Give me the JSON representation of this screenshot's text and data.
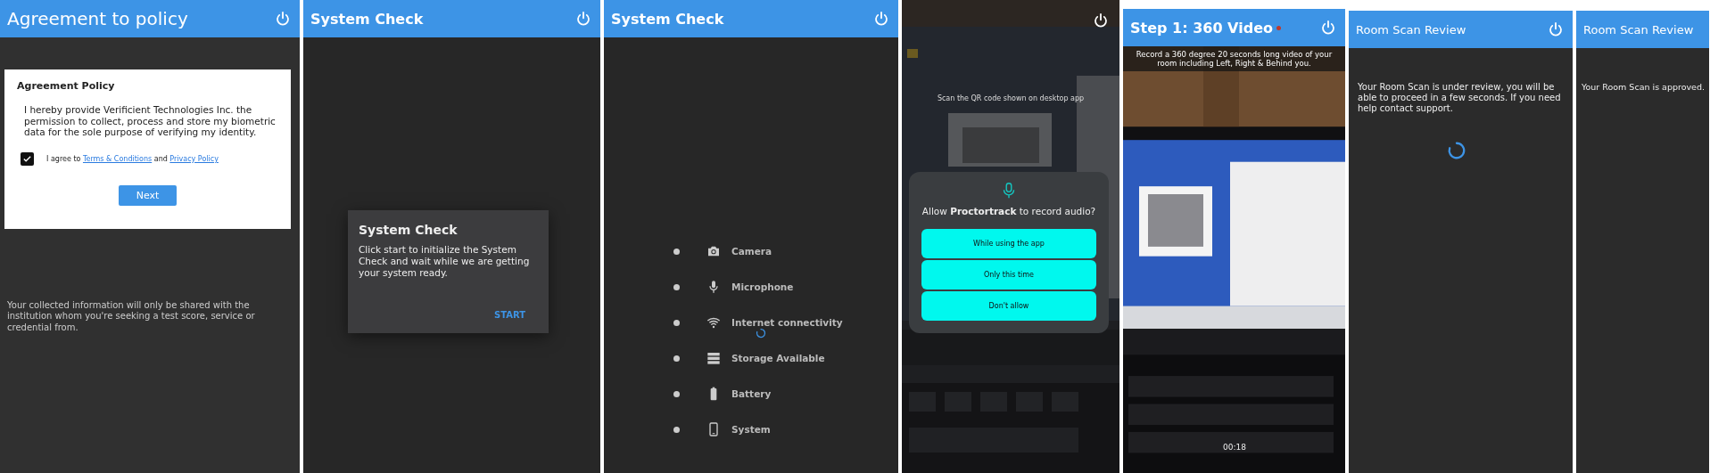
{
  "screens": [
    {
      "kind": "agreement",
      "title": "Agreement to policy",
      "power": true,
      "card": {
        "heading": "Agreement Policy",
        "body": "I hereby provide Verificient Technologies Inc. the permission to collect, process and store my biometric data for the sole purpose of verifying my identity.",
        "consent": {
          "checked": true,
          "prefix": "I agree to",
          "link_1": "Terms & Conditions",
          "joiner": "and",
          "link_2": "Privacy Policy"
        },
        "button": "Next"
      },
      "footer": "Your collected information will only be shared with the institution whom you're seeking a test score, service or credential from."
    },
    {
      "kind": "dialog",
      "title": "System Check",
      "power": true,
      "dialog": {
        "heading": "System Check",
        "body": "Click start to initialize the System Check and wait while we are getting your system ready.",
        "action": "START"
      }
    },
    {
      "kind": "checklist",
      "title": "System Check",
      "power": true,
      "loading": true,
      "items": [
        {
          "kind": "camera",
          "label": "Camera"
        },
        {
          "kind": "microphone",
          "label": "Microphone"
        },
        {
          "kind": "wifi",
          "label": "Internet connectivity"
        },
        {
          "kind": "storage",
          "label": "Storage Available"
        },
        {
          "kind": "battery",
          "label": "Battery"
        },
        {
          "kind": "phone",
          "label": "System"
        }
      ]
    },
    {
      "kind": "permission",
      "power": true,
      "caption": "Scan the QR code shown on desktop app",
      "prompt": "Allow **Proctortrack** to record audio?",
      "options": [
        "While using the app",
        "Only this time",
        "Don't allow"
      ]
    },
    {
      "kind": "video",
      "title": "Step 1: 360 Video",
      "power": true,
      "recording": true,
      "instruction": "Record a 360 degree 20 seconds long video of your room including Left, Right & Behind you.",
      "timer": "00:18"
    },
    {
      "kind": "review",
      "title": "Room Scan Review",
      "power": true,
      "loading": true,
      "message": "Your Room Scan is under review, you will be able to proceed in a few seconds. If you need help contact support."
    },
    {
      "kind": "review",
      "title": "Room Scan Review",
      "power": false,
      "loading": false,
      "message": "Your Room Scan is approved."
    }
  ]
}
